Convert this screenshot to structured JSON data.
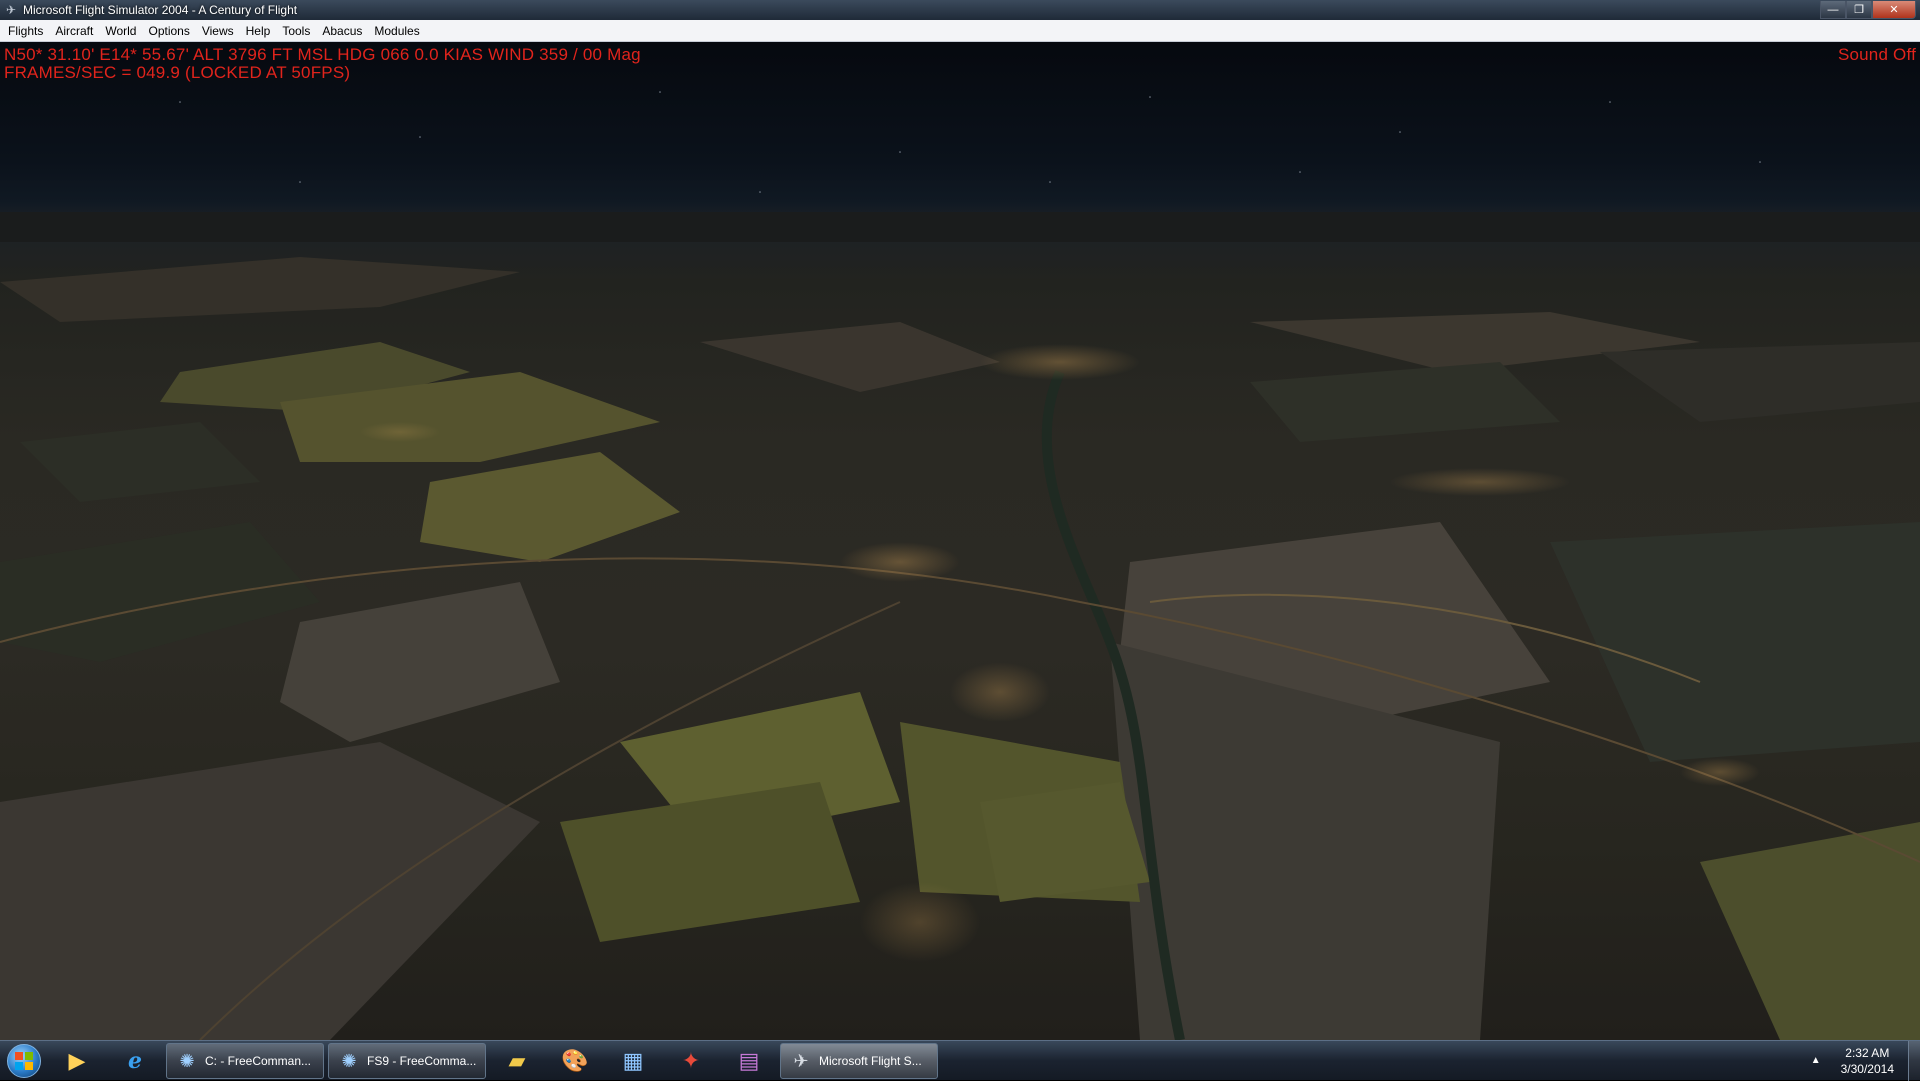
{
  "window": {
    "title": "Microsoft Flight Simulator 2004 - A Century of Flight",
    "minimize_glyph": "—",
    "maximize_glyph": "❐",
    "close_glyph": "✕"
  },
  "menu": [
    {
      "label": "Flights"
    },
    {
      "label": "Aircraft"
    },
    {
      "label": "World"
    },
    {
      "label": "Options"
    },
    {
      "label": "Views"
    },
    {
      "label": "Help"
    },
    {
      "label": "Tools"
    },
    {
      "label": "Abacus"
    },
    {
      "label": "Modules"
    }
  ],
  "hud": {
    "line1": "N50* 31.10'  E14* 55.67'  ALT  3796 FT  MSL  HDG 066   0.0 KIAS   WIND 359 / 00 Mag",
    "line2": "FRAMES/SEC = 049.9 (LOCKED AT 50FPS)",
    "sound": "Sound Off",
    "color": "#e0241c"
  },
  "taskbar": {
    "pinned": [
      {
        "icon": "media-player-icon"
      },
      {
        "icon": "internet-explorer-icon"
      }
    ],
    "tasks": [
      {
        "label": "C: - FreeComman...",
        "icon": "freecommander-icon"
      },
      {
        "label": "FS9 - FreeComma...",
        "icon": "freecommander-icon"
      }
    ],
    "pinned2": [
      {
        "icon": "file-explorer-icon"
      },
      {
        "icon": "paint-icon"
      },
      {
        "icon": "control-panel-icon"
      },
      {
        "icon": "media-center-icon"
      },
      {
        "icon": "winrar-icon"
      }
    ],
    "active_task": {
      "label": "Microsoft Flight S...",
      "icon": "airplane-icon"
    },
    "clock": {
      "time": "2:32 AM",
      "date": "3/30/2014"
    }
  }
}
